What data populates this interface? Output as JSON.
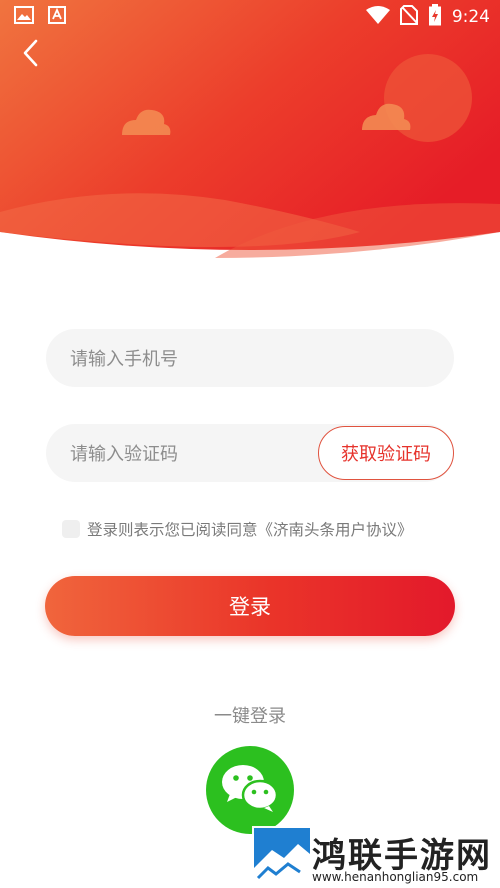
{
  "status_bar": {
    "time": "9:24"
  },
  "form": {
    "phone_placeholder": "请输入手机号",
    "code_placeholder": "请输入验证码",
    "get_code_label": "获取验证码",
    "agreement_text": "登录则表示您已阅读同意《济南头条用户协议》",
    "login_label": "登录",
    "quick_login_label": "一键登录"
  },
  "watermark": {
    "title": "鸿联手游网",
    "url": "www.henanhonglian95.com"
  },
  "colors": {
    "brand_red": "#e6322b",
    "wechat_green": "#2cc01f"
  },
  "icons": {
    "status_left": [
      "image-icon",
      "font-app-icon"
    ],
    "status_right": [
      "wifi-icon",
      "no-sim-icon",
      "battery-charging-icon"
    ],
    "back": "chevron-left-icon",
    "wechat": "wechat-icon"
  }
}
